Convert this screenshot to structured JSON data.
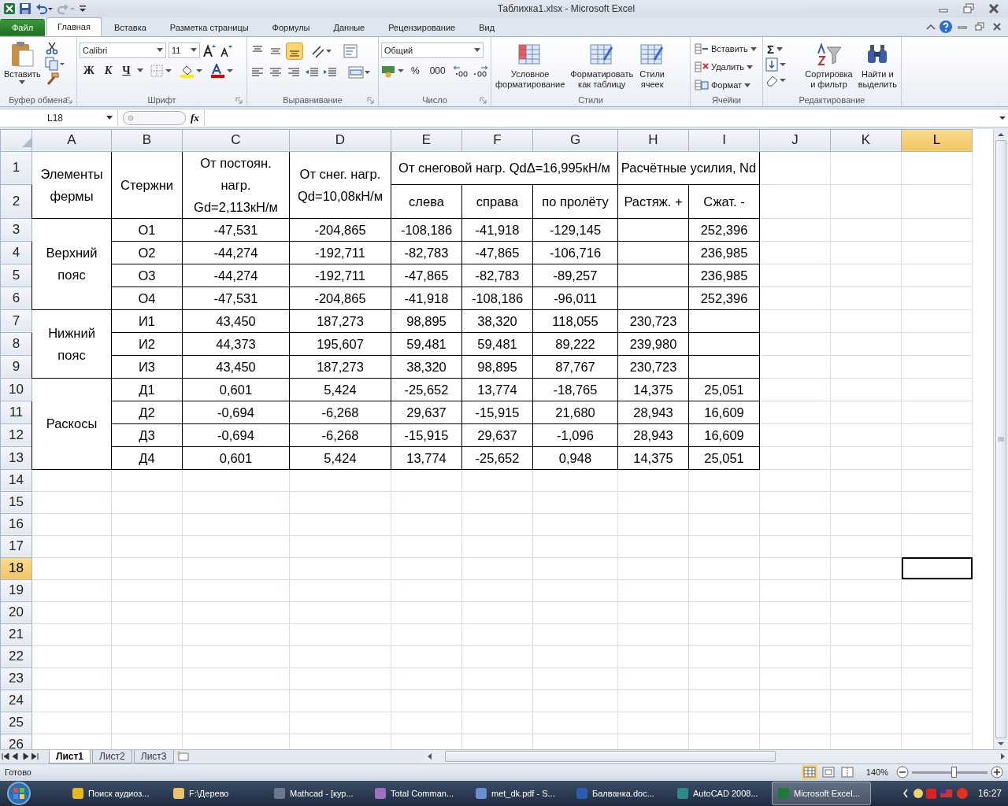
{
  "window": {
    "title": "Таблихка1.xlsx - Microsoft Excel"
  },
  "ribbon_tabs": [
    {
      "label": "Файл",
      "kind": "file",
      "selected": false
    },
    {
      "label": "Главная",
      "kind": "tab",
      "selected": true
    },
    {
      "label": "Вставка",
      "kind": "tab",
      "selected": false
    },
    {
      "label": "Разметка страницы",
      "kind": "tab",
      "selected": false
    },
    {
      "label": "Формулы",
      "kind": "tab",
      "selected": false
    },
    {
      "label": "Данные",
      "kind": "tab",
      "selected": false
    },
    {
      "label": "Рецензирование",
      "kind": "tab",
      "selected": false
    },
    {
      "label": "Вид",
      "kind": "tab",
      "selected": false
    }
  ],
  "clipboard": {
    "label": "Буфер обмена",
    "paste": "Вставить"
  },
  "font": {
    "label": "Шрифт",
    "family": "Calibri",
    "size": "11",
    "bold": "Ж",
    "italic": "К",
    "underline": "Ч"
  },
  "alignment": {
    "label": "Выравнивание"
  },
  "number": {
    "label": "Число",
    "format": "Общий",
    "percent": "%",
    "thousands": "000"
  },
  "styles": {
    "label": "Стили",
    "buttons": [
      "Условное\nформатирование",
      "Форматировать\nкак таблицу",
      "Стили\nячеек"
    ]
  },
  "cells": {
    "label": "Ячейки",
    "buttons": [
      "Вставить",
      "Удалить",
      "Формат"
    ]
  },
  "editing": {
    "label": "Редактирование",
    "sum": "Σ",
    "buttons": [
      "Сортировка\nи фильтр",
      "Найти и\nвыделить"
    ]
  },
  "formula_bar": {
    "name_box": "L18",
    "fx": "fx"
  },
  "sheet": {
    "columns": [
      {
        "letter": "A",
        "selected": false
      },
      {
        "letter": "B",
        "selected": false
      },
      {
        "letter": "C",
        "selected": false
      },
      {
        "letter": "D",
        "selected": false
      },
      {
        "letter": "E",
        "selected": false
      },
      {
        "letter": "F",
        "selected": false
      },
      {
        "letter": "G",
        "selected": false
      },
      {
        "letter": "H",
        "selected": false
      },
      {
        "letter": "I",
        "selected": false
      },
      {
        "letter": "J",
        "selected": false
      },
      {
        "letter": "K",
        "selected": false
      },
      {
        "letter": "L",
        "selected": true
      }
    ],
    "rows": [
      {
        "number": "1",
        "selected": false,
        "cells": [
          {
            "kind": "text",
            "text": "Элементы фермы",
            "rowspan": 2
          },
          {
            "kind": "text",
            "text": "Стержни",
            "rowspan": 2
          },
          {
            "kind": "text",
            "text": "От постоян. нагр. Gd=2,113кН/м",
            "rowspan": 2
          },
          {
            "kind": "text",
            "text": "От снег. нагр. Qd=10,08кН/м",
            "rowspan": 2
          },
          {
            "kind": "text",
            "text": "От снеговой нагр. QdΔ=16,995кН/м",
            "colspan": 3
          },
          {
            "kind": "text",
            "text": "Расчётные усилия, Nd",
            "colspan": 2
          }
        ]
      },
      {
        "number": "2",
        "selected": false,
        "cells": [
          {
            "kind": "text",
            "text": "слева"
          },
          {
            "kind": "text",
            "text": "справа"
          },
          {
            "kind": "text",
            "text": "по пролёту"
          },
          {
            "kind": "text",
            "text": "Растяж. +"
          },
          {
            "kind": "text",
            "text": "Сжат. -"
          }
        ]
      },
      {
        "number": "3",
        "selected": false,
        "cells": [
          {
            "kind": "text",
            "text": "Верхний пояс",
            "rowspan": 4
          },
          {
            "kind": "text",
            "text": "О1"
          },
          {
            "kind": "text",
            "text": "-47,531"
          },
          {
            "kind": "text",
            "text": "-204,865"
          },
          {
            "kind": "text",
            "text": "-108,186"
          },
          {
            "kind": "text",
            "text": "-41,918"
          },
          {
            "kind": "text",
            "text": "-129,145"
          },
          {
            "kind": "blank"
          },
          {
            "kind": "text",
            "text": "252,396"
          }
        ]
      },
      {
        "number": "4",
        "selected": false,
        "cells": [
          {
            "kind": "text",
            "text": "О2"
          },
          {
            "kind": "text",
            "text": "-44,274"
          },
          {
            "kind": "text",
            "text": "-192,711"
          },
          {
            "kind": "text",
            "text": "-82,783"
          },
          {
            "kind": "text",
            "text": "-47,865"
          },
          {
            "kind": "text",
            "text": "-106,716"
          },
          {
            "kind": "blank"
          },
          {
            "kind": "text",
            "text": "236,985"
          }
        ]
      },
      {
        "number": "5",
        "selected": false,
        "cells": [
          {
            "kind": "text",
            "text": "О3"
          },
          {
            "kind": "text",
            "text": "-44,274"
          },
          {
            "kind": "text",
            "text": "-192,711"
          },
          {
            "kind": "text",
            "text": "-47,865"
          },
          {
            "kind": "text",
            "text": "-82,783"
          },
          {
            "kind": "text",
            "text": "-89,257"
          },
          {
            "kind": "blank"
          },
          {
            "kind": "text",
            "text": "236,985"
          }
        ]
      },
      {
        "number": "6",
        "selected": false,
        "cells": [
          {
            "kind": "text",
            "text": "О4"
          },
          {
            "kind": "text",
            "text": "-47,531"
          },
          {
            "kind": "text",
            "text": "-204,865"
          },
          {
            "kind": "text",
            "text": "-41,918"
          },
          {
            "kind": "text",
            "text": "-108,186"
          },
          {
            "kind": "text",
            "text": "-96,011"
          },
          {
            "kind": "blank"
          },
          {
            "kind": "text",
            "text": "252,396"
          }
        ]
      },
      {
        "number": "7",
        "selected": false,
        "cells": [
          {
            "kind": "text",
            "text": "Нижний пояс",
            "rowspan": 3
          },
          {
            "kind": "text",
            "text": "И1"
          },
          {
            "kind": "text",
            "text": "43,450"
          },
          {
            "kind": "text",
            "text": "187,273"
          },
          {
            "kind": "text",
            "text": "98,895"
          },
          {
            "kind": "text",
            "text": "38,320"
          },
          {
            "kind": "text",
            "text": "118,055"
          },
          {
            "kind": "text",
            "text": "230,723"
          },
          {
            "kind": "blank"
          }
        ]
      },
      {
        "number": "8",
        "selected": false,
        "cells": [
          {
            "kind": "text",
            "text": "И2"
          },
          {
            "kind": "text",
            "text": "44,373"
          },
          {
            "kind": "text",
            "text": "195,607"
          },
          {
            "kind": "text",
            "text": "59,481"
          },
          {
            "kind": "text",
            "text": "59,481"
          },
          {
            "kind": "text",
            "text": "89,222"
          },
          {
            "kind": "text",
            "text": "239,980"
          },
          {
            "kind": "blank"
          }
        ]
      },
      {
        "number": "9",
        "selected": false,
        "cells": [
          {
            "kind": "text",
            "text": "И3"
          },
          {
            "kind": "text",
            "text": "43,450"
          },
          {
            "kind": "text",
            "text": "187,273"
          },
          {
            "kind": "text",
            "text": "38,320"
          },
          {
            "kind": "text",
            "text": "98,895"
          },
          {
            "kind": "text",
            "text": "87,767"
          },
          {
            "kind": "text",
            "text": "230,723"
          },
          {
            "kind": "blank"
          }
        ]
      },
      {
        "number": "10",
        "selected": false,
        "cells": [
          {
            "kind": "text",
            "text": "Раскосы",
            "rowspan": 4
          },
          {
            "kind": "text",
            "text": "Д1"
          },
          {
            "kind": "text",
            "text": "0,601"
          },
          {
            "kind": "text",
            "text": "5,424"
          },
          {
            "kind": "text",
            "text": "-25,652"
          },
          {
            "kind": "text",
            "text": "13,774"
          },
          {
            "kind": "text",
            "text": "-18,765"
          },
          {
            "kind": "text",
            "text": "14,375"
          },
          {
            "kind": "text",
            "text": "25,051"
          }
        ]
      },
      {
        "number": "11",
        "selected": false,
        "cells": [
          {
            "kind": "text",
            "text": "Д2"
          },
          {
            "kind": "text",
            "text": "-0,694"
          },
          {
            "kind": "text",
            "text": "-6,268"
          },
          {
            "kind": "text",
            "text": "29,637"
          },
          {
            "kind": "text",
            "text": "-15,915"
          },
          {
            "kind": "text",
            "text": "21,680"
          },
          {
            "kind": "text",
            "text": "28,943"
          },
          {
            "kind": "text",
            "text": "16,609"
          }
        ]
      },
      {
        "number": "12",
        "selected": false,
        "cells": [
          {
            "kind": "text",
            "text": "Д3"
          },
          {
            "kind": "text",
            "text": "-0,694"
          },
          {
            "kind": "text",
            "text": "-6,268"
          },
          {
            "kind": "text",
            "text": "-15,915"
          },
          {
            "kind": "text",
            "text": "29,637"
          },
          {
            "kind": "text",
            "text": "-1,096"
          },
          {
            "kind": "text",
            "text": "28,943"
          },
          {
            "kind": "text",
            "text": "16,609"
          }
        ]
      },
      {
        "number": "13",
        "selected": false,
        "cells": [
          {
            "kind": "text",
            "text": "Д4"
          },
          {
            "kind": "text",
            "text": "0,601"
          },
          {
            "kind": "text",
            "text": "5,424"
          },
          {
            "kind": "text",
            "text": "13,774"
          },
          {
            "kind": "text",
            "text": "-25,652"
          },
          {
            "kind": "text",
            "text": "0,948"
          },
          {
            "kind": "text",
            "text": "14,375"
          },
          {
            "kind": "text",
            "text": "25,051"
          }
        ]
      },
      {
        "number": "14",
        "selected": false,
        "cells": []
      },
      {
        "number": "15",
        "selected": false,
        "cells": []
      },
      {
        "number": "16",
        "selected": false,
        "cells": []
      },
      {
        "number": "17",
        "selected": false,
        "cells": []
      },
      {
        "number": "18",
        "selected": true,
        "cells": []
      },
      {
        "number": "19",
        "selected": false,
        "cells": []
      },
      {
        "number": "20",
        "selected": false,
        "cells": []
      },
      {
        "number": "21",
        "selected": false,
        "cells": []
      },
      {
        "number": "22",
        "selected": false,
        "cells": []
      },
      {
        "number": "23",
        "selected": false,
        "cells": []
      },
      {
        "number": "24",
        "selected": false,
        "cells": []
      },
      {
        "number": "25",
        "selected": false,
        "cells": []
      },
      {
        "number": "26",
        "selected": false,
        "cells": []
      }
    ]
  },
  "sheet_tabs": [
    {
      "label": "Лист1",
      "selected": true
    },
    {
      "label": "Лист2",
      "selected": false
    },
    {
      "label": "Лист3",
      "selected": false
    }
  ],
  "status_bar": {
    "text": "Готово",
    "zoom": "140%",
    "zoom_slider": {
      "level": 0.55
    }
  },
  "taskbar": {
    "items": [
      {
        "label": "Поиск аудиоз...",
        "kind": "browser",
        "selected": false
      },
      {
        "label": "F:\\Дерево",
        "kind": "folder",
        "selected": false
      },
      {
        "label": "Mathcad - [кур...",
        "kind": "mathcad",
        "selected": false
      },
      {
        "label": "Total Comman...",
        "kind": "commander",
        "selected": false
      },
      {
        "label": "met_dk.pdf - S...",
        "kind": "pdf",
        "selected": false
      },
      {
        "label": "Балванка.doc...",
        "kind": "word",
        "selected": false
      },
      {
        "label": "AutoCAD 2008...",
        "kind": "autocad",
        "selected": false
      },
      {
        "label": "Microsoft Excel...",
        "kind": "excel",
        "selected": true
      }
    ],
    "clock": "16:27"
  }
}
